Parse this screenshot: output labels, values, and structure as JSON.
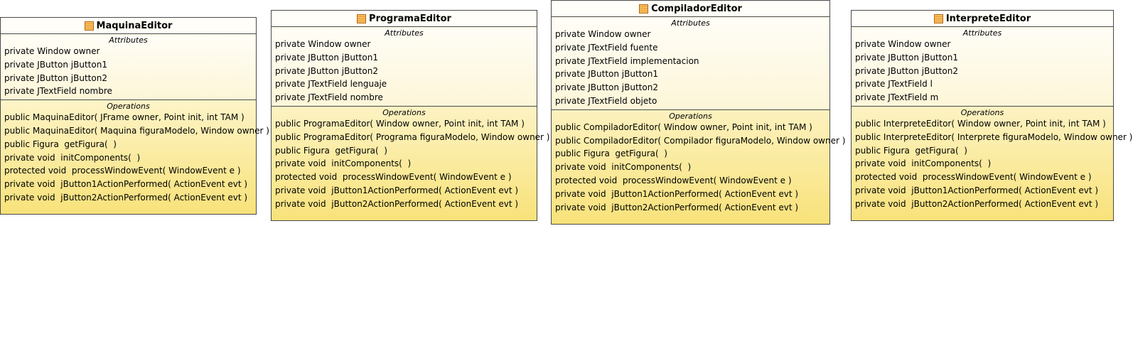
{
  "classes": [
    {
      "name": "MaquinaEditor",
      "attributes_title": "Attributes",
      "attributes": [
        "private Window owner",
        "private JButton jButton1",
        "private JButton jButton2",
        "private JTextField nombre"
      ],
      "operations_title": "Operations",
      "operations": [
        "public MaquinaEditor( JFrame owner, Point init, int TAM )",
        "public MaquinaEditor( Maquina figuraModelo, Window owner )",
        "public Figura  getFigura(  )",
        "private void  initComponents(  )",
        "protected void  processWindowEvent( WindowEvent e )",
        "private void  jButton1ActionPerformed( ActionEvent evt )",
        "private void  jButton2ActionPerformed( ActionEvent evt )"
      ]
    },
    {
      "name": "ProgramaEditor",
      "attributes_title": "Attributes",
      "attributes": [
        "private Window owner",
        "private JButton jButton1",
        "private JButton jButton2",
        "private JTextField lenguaje",
        "private JTextField nombre"
      ],
      "operations_title": "Operations",
      "operations": [
        "public ProgramaEditor( Window owner, Point init, int TAM )",
        "public ProgramaEditor( Programa figuraModelo, Window owner )",
        "public Figura  getFigura(  )",
        "private void  initComponents(  )",
        "protected void  processWindowEvent( WindowEvent e )",
        "private void  jButton1ActionPerformed( ActionEvent evt )",
        "private void  jButton2ActionPerformed( ActionEvent evt )"
      ]
    },
    {
      "name": "CompiladorEditor",
      "attributes_title": "Attributes",
      "attributes": [
        "private Window owner",
        "private JTextField fuente",
        "private JTextField implementacion",
        "private JButton jButton1",
        "private JButton jButton2",
        "private JTextField objeto"
      ],
      "operations_title": "Operations",
      "operations": [
        "public CompiladorEditor( Window owner, Point init, int TAM )",
        "public CompiladorEditor( Compilador figuraModelo, Window owner )",
        "public Figura  getFigura(  )",
        "private void  initComponents(  )",
        "protected void  processWindowEvent( WindowEvent e )",
        "private void  jButton1ActionPerformed( ActionEvent evt )",
        "private void  jButton2ActionPerformed( ActionEvent evt )"
      ]
    },
    {
      "name": "InterpreteEditor",
      "attributes_title": "Attributes",
      "attributes": [
        "private Window owner",
        "private JButton jButton1",
        "private JButton jButton2",
        "private JTextField l",
        "private JTextField m"
      ],
      "operations_title": "Operations",
      "operations": [
        "public InterpreteEditor( Window owner, Point init, int TAM )",
        "public InterpreteEditor( Interprete figuraModelo, Window owner )",
        "public Figura  getFigura(  )",
        "private void  initComponents(  )",
        "protected void  processWindowEvent( WindowEvent e )",
        "private void  jButton1ActionPerformed( ActionEvent evt )",
        "private void  jButton2ActionPerformed( ActionEvent evt )"
      ]
    }
  ]
}
